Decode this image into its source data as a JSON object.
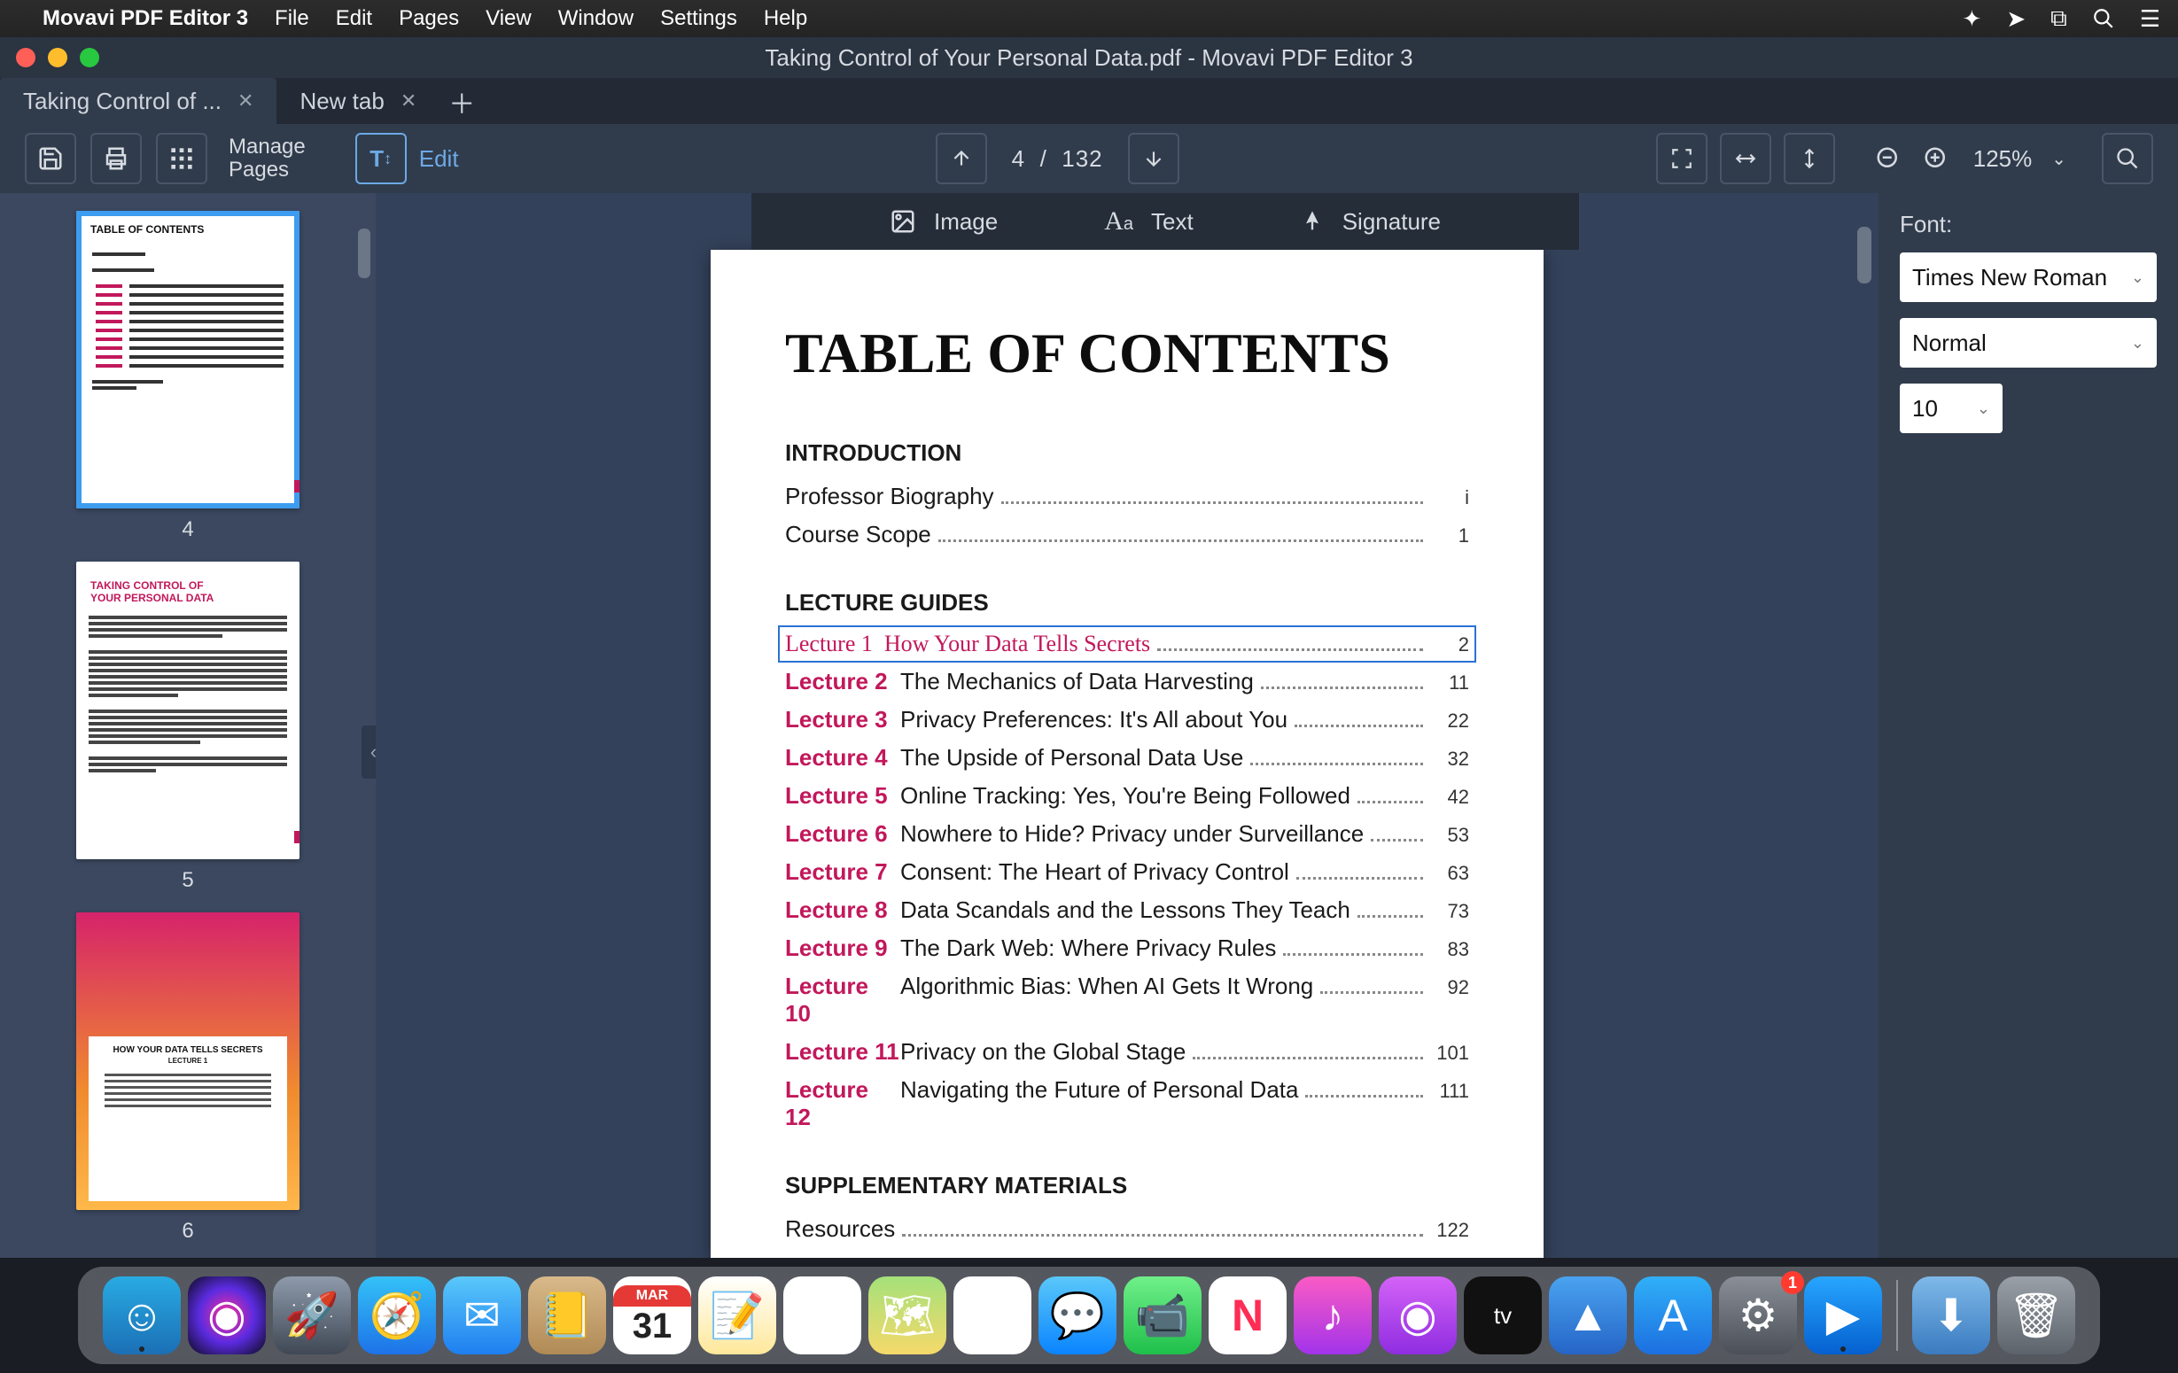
{
  "menubar": {
    "app_name": "Movavi PDF Editor 3",
    "items": [
      "File",
      "Edit",
      "Pages",
      "View",
      "Window",
      "Settings",
      "Help"
    ]
  },
  "window": {
    "title": "Taking Control of Your Personal Data.pdf - Movavi PDF Editor 3"
  },
  "tabs": [
    {
      "label": "Taking Control of ...",
      "active": true
    },
    {
      "label": "New tab",
      "active": false
    }
  ],
  "toolbar": {
    "manage_pages": "Manage\nPages",
    "edit_label": "Edit",
    "page_current": "4",
    "page_sep": "/",
    "page_total": "132",
    "zoom_label": "125%"
  },
  "subbar": {
    "image": "Image",
    "text": "Text",
    "signature": "Signature"
  },
  "thumbnails": {
    "page_numbers": [
      "4",
      "5",
      "6"
    ]
  },
  "document": {
    "title": "TABLE OF CONTENTS",
    "section_intro": "INTRODUCTION",
    "section_lectures": "LECTURE GUIDES",
    "section_supp": "SUPPLEMENTARY MATERIALS",
    "intro_rows": [
      {
        "title": "Professor Biography",
        "page": "i"
      },
      {
        "title": "Course Scope",
        "page": "1"
      }
    ],
    "lecture_rows": [
      {
        "lec": "Lecture 1",
        "title": "How Your Data Tells Secrets",
        "page": "2",
        "selected": true
      },
      {
        "lec": "Lecture 2",
        "title": "The Mechanics of Data Harvesting",
        "page": "11"
      },
      {
        "lec": "Lecture 3",
        "title": "Privacy Preferences: It's All about You",
        "page": "22"
      },
      {
        "lec": "Lecture 4",
        "title": "The Upside of Personal Data Use",
        "page": "32"
      },
      {
        "lec": "Lecture 5",
        "title": "Online Tracking: Yes, You're Being Followed",
        "page": "42"
      },
      {
        "lec": "Lecture 6",
        "title": "Nowhere to Hide? Privacy under Surveillance",
        "page": "53"
      },
      {
        "lec": "Lecture 7",
        "title": "Consent: The Heart of Privacy Control",
        "page": "63"
      },
      {
        "lec": "Lecture 8",
        "title": "Data Scandals and the Lessons They Teach",
        "page": "73"
      },
      {
        "lec": "Lecture 9",
        "title": "The Dark Web: Where Privacy Rules",
        "page": "83"
      },
      {
        "lec": "Lecture 10",
        "title": "Algorithmic Bias: When AI Gets It Wrong",
        "page": "92"
      },
      {
        "lec": "Lecture 11",
        "title": "Privacy on the Global Stage",
        "page": "101"
      },
      {
        "lec": "Lecture 12",
        "title": "Navigating the Future of Personal Data",
        "page": "111"
      }
    ],
    "supp_rows": [
      {
        "title": "Resources",
        "page": "122"
      }
    ]
  },
  "font_panel": {
    "label": "Font:",
    "family": "Times New Roman",
    "style": "Normal",
    "size": "10"
  },
  "dock": {
    "calendar_month": "MAR",
    "calendar_day": "31",
    "pref_badge": "1"
  },
  "thumb5": {
    "line1": "TAKING CONTROL OF",
    "line2": "YOUR PERSONAL DATA"
  },
  "thumb6": {
    "title": "HOW YOUR DATA TELLS SECRETS",
    "lecture": "LECTURE 1"
  }
}
